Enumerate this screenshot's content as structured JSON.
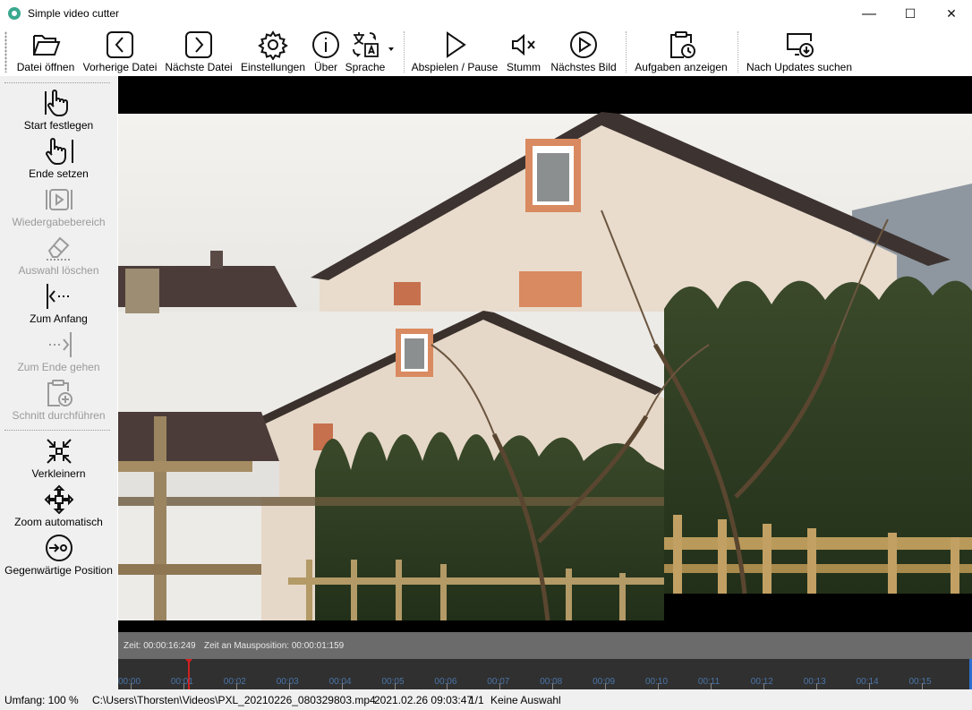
{
  "window": {
    "title": "Simple video cutter",
    "minimize_label": "—",
    "maximize_label": "☐",
    "close_label": "✕"
  },
  "toolbar": {
    "open_file": "Datei öffnen",
    "previous_file": "Vorherige Datei",
    "next_file": "Nächste Datei",
    "settings": "Einstellungen",
    "about": "Über",
    "language": "Sprache",
    "play_pause": "Abspielen / Pause",
    "mute": "Stumm",
    "next_frame": "Nächstes Bild",
    "show_tasks": "Aufgaben anzeigen",
    "check_updates": "Nach Updates suchen"
  },
  "sidebar": {
    "set_start": "Start festlegen",
    "set_end": "Ende setzen",
    "play_range": "Wiedergabebereich",
    "clear_selection": "Auswahl löschen",
    "go_start": "Zum Anfang",
    "go_end": "Zum Ende gehen",
    "perform_cut": "Schnitt durchführen",
    "zoom_out": "Verkleinern",
    "zoom_auto": "Zoom automatisch",
    "current_position": "Gegenwärtige Position"
  },
  "info": {
    "time": "Zeit: 00:00:16:249",
    "mouse_time": "Zeit an Mausposition: 00:00:01:159"
  },
  "timeline": {
    "ticks": [
      "00:00",
      "00:01",
      "00:02",
      "00:03",
      "00:04",
      "00:05",
      "00:06",
      "00:07",
      "00:08",
      "00:09",
      "00:10",
      "00:11",
      "00:12",
      "00:13",
      "00:14",
      "00:15"
    ],
    "cursor_position_seconds": 1.1
  },
  "status": {
    "zoom": "Umfang: 100 %",
    "path": "C:\\Users\\Thorsten\\Videos\\PXL_20210226_080329803.mp4",
    "datetime": "2021.02.26 09:03:47",
    "count": "1/1",
    "selection": "Keine Auswahl"
  },
  "colors": {
    "accent": "#3aa88f",
    "cursor": "#d02020",
    "tick_text": "#4a74a8"
  }
}
